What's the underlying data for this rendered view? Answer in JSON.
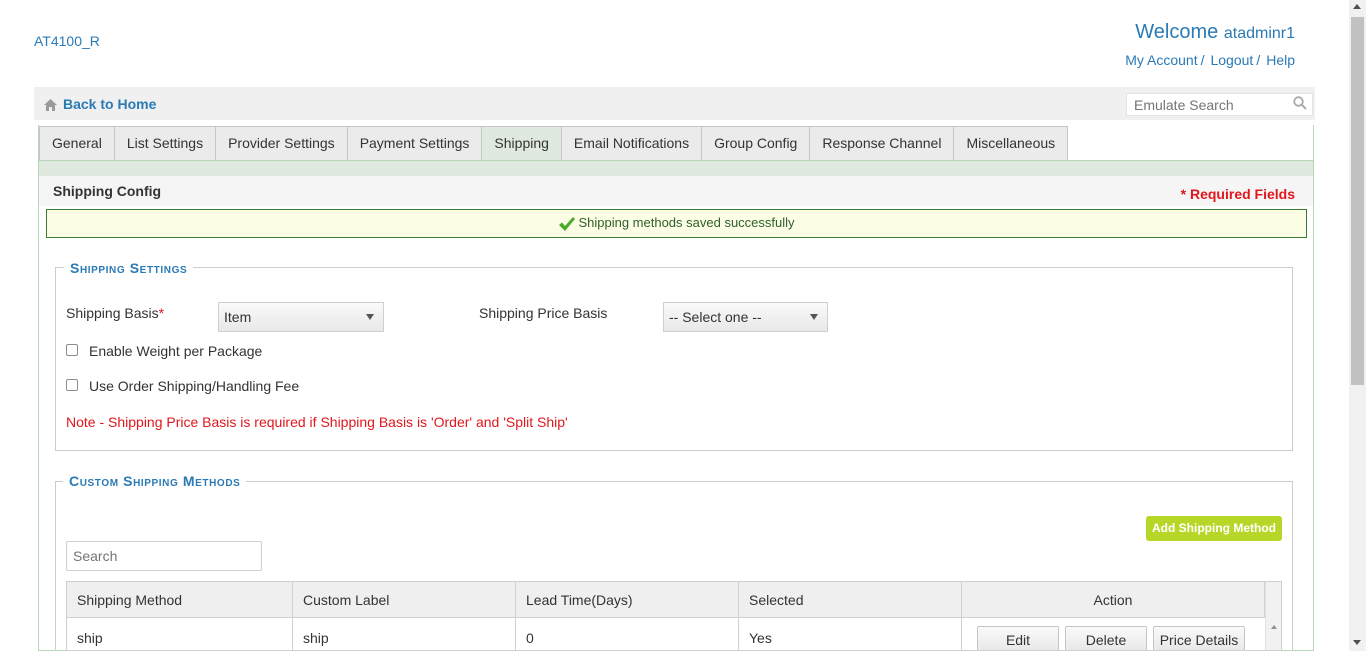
{
  "header": {
    "brand": "AT4100_R",
    "welcome_prefix": "Welcome",
    "username": "atadminr1",
    "links": [
      "My Account",
      "Logout",
      "Help"
    ]
  },
  "topbar": {
    "home_label": "Back to Home",
    "emulate_placeholder": "Emulate Search"
  },
  "tabs": [
    "General",
    "List Settings",
    "Provider Settings",
    "Payment Settings",
    "Shipping",
    "Email Notifications",
    "Group Config",
    "Response Channel",
    "Miscellaneous"
  ],
  "active_tab": "Shipping",
  "panel": {
    "title": "Shipping Config",
    "required_note": "* Required Fields",
    "success_message": "Shipping methods saved successfully"
  },
  "shipping_settings": {
    "legend": "Shipping Settings",
    "basis_label": "Shipping Basis",
    "basis_star": "*",
    "basis_value": "Item",
    "price_basis_label": "Shipping Price Basis",
    "price_basis_value": "-- Select one --",
    "weight_checkbox": "Enable Weight per Package",
    "order_fee_checkbox": "Use Order Shipping/Handling Fee",
    "note": "Note - Shipping Price Basis is required if Shipping Basis is 'Order' and 'Split Ship'"
  },
  "custom_methods": {
    "legend": "Custom Shipping Methods",
    "add_button": "Add Shipping Method",
    "search_placeholder": "Search",
    "columns": [
      "Shipping Method",
      "Custom Label",
      "Lead Time(Days)",
      "Selected",
      "Action"
    ],
    "rows": [
      {
        "method": "ship",
        "label": "ship",
        "lead_time": "0",
        "selected": "Yes"
      }
    ],
    "row_actions": [
      "Edit",
      "Delete",
      "Price Details"
    ]
  },
  "colors": {
    "link_blue": "#2a7ab5",
    "required_red": "#e0171d",
    "add_button_green": "#b6d727",
    "success_bg": "#fbfde5"
  }
}
